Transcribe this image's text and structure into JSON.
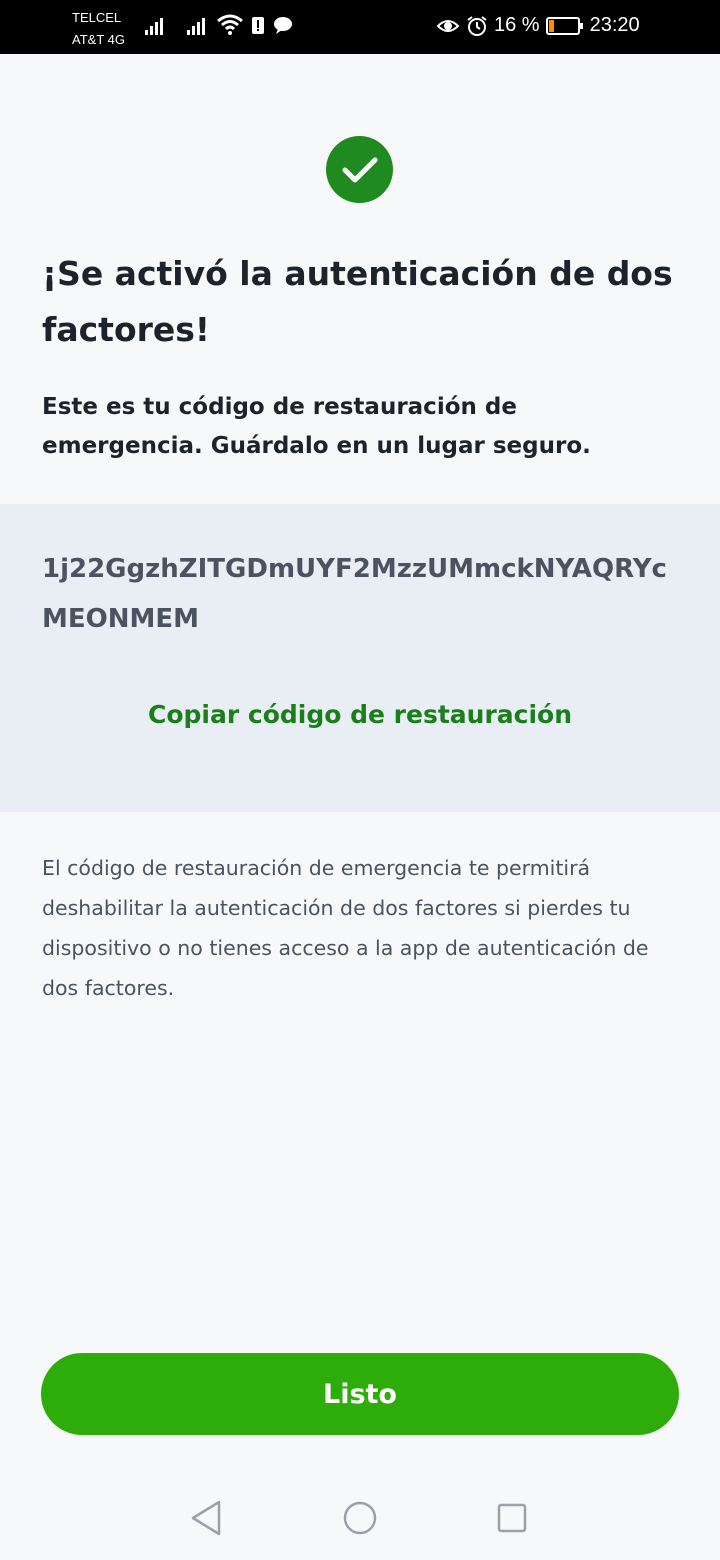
{
  "status_bar": {
    "carrier_1": "TELCEL",
    "carrier_2": "AT&T 4G",
    "battery_percent": "16 %",
    "time": "23:20"
  },
  "main": {
    "title": "¡Se activó la autenticación de dos factores!",
    "subtitle": "Este es tu código de restauración de emergencia. Guárdalo en un lugar seguro.",
    "recovery_code": "1j22GgzhZITGDmUYF2MzzUMmckNYAQRYcMEONMEM",
    "copy_label": "Copiar código de restauración",
    "info": "El código de restauración de emergencia te permitirá deshabilitar la autenticación de dos factores si pierdes tu dispositivo o no tienes acceso a la app de autenticación de dos factores.",
    "done_label": "Listo"
  },
  "colors": {
    "accent_green": "#2eac0a",
    "success_green": "#1f8a1f",
    "link_green": "#1a7f1a",
    "panel_bg": "#e9edf4"
  },
  "icons": [
    "success-check-icon",
    "back-nav-icon",
    "home-nav-icon",
    "recents-nav-icon",
    "wifi-icon",
    "signal-icon",
    "alarm-icon",
    "eye-icon",
    "battery-icon"
  ]
}
